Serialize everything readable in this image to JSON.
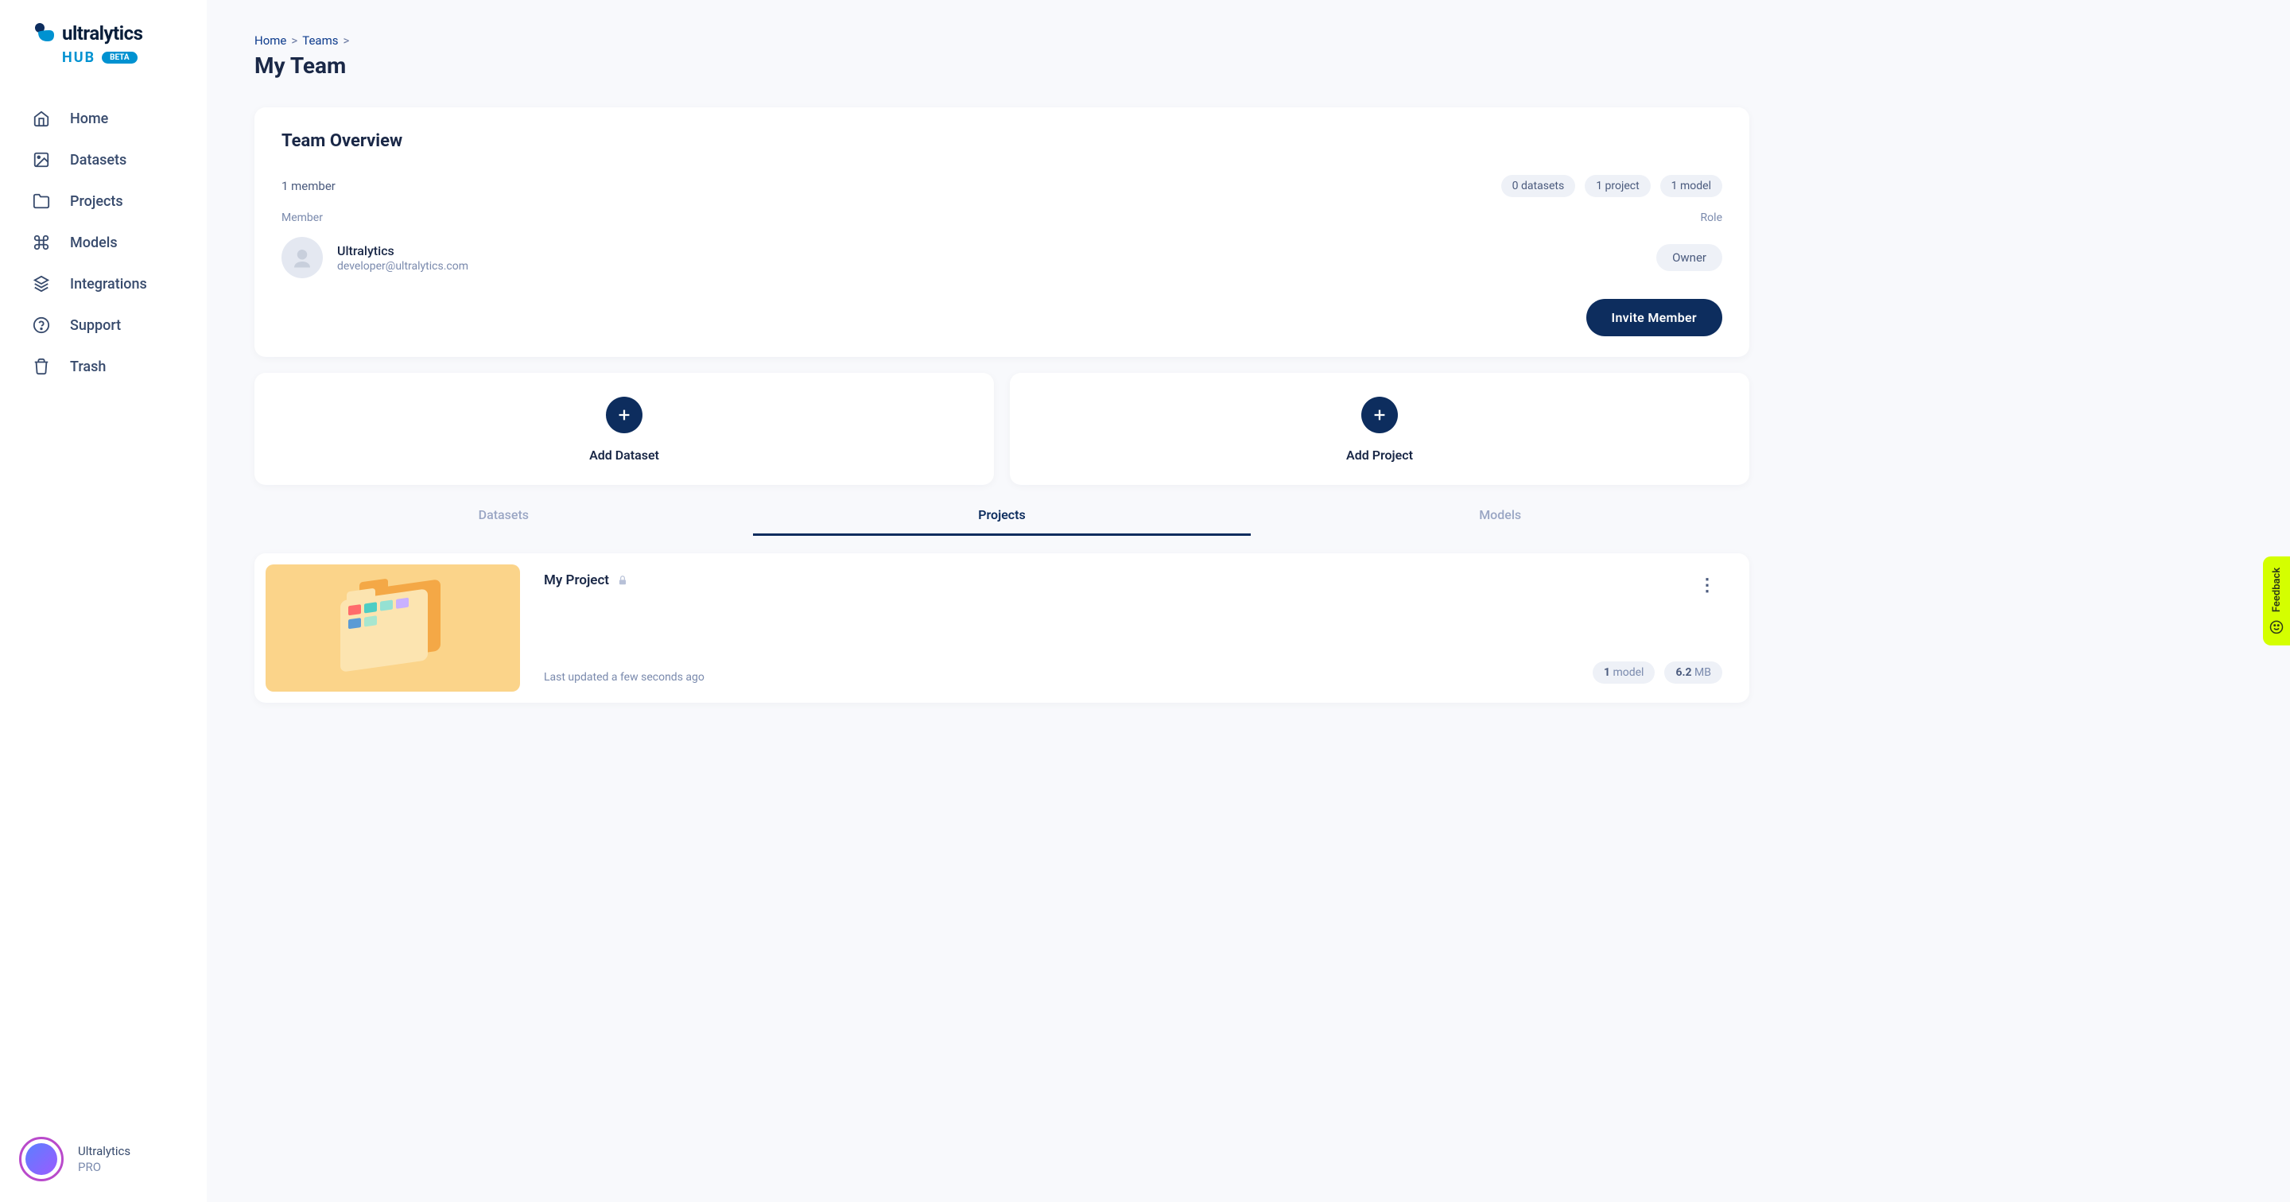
{
  "brand": {
    "name": "ultralytics",
    "sub": "HUB",
    "badge": "BETA"
  },
  "nav": {
    "home": "Home",
    "datasets": "Datasets",
    "projects": "Projects",
    "models": "Models",
    "integrations": "Integrations",
    "support": "Support",
    "trash": "Trash"
  },
  "user": {
    "name": "Ultralytics",
    "plan": "PRO"
  },
  "breadcrumb": {
    "home": "Home",
    "teams": "Teams"
  },
  "page": {
    "title": "My Team"
  },
  "overview": {
    "title": "Team Overview",
    "member_count": "1 member",
    "datasets_pill": "0 datasets",
    "projects_pill": "1 project",
    "models_pill": "1 model",
    "col_member": "Member",
    "col_role": "Role",
    "member_name": "Ultralytics",
    "member_email": "developer@ultralytics.com",
    "role_label": "Owner",
    "invite_label": "Invite Member"
  },
  "add": {
    "dataset": "Add Dataset",
    "project": "Add Project"
  },
  "tabs": {
    "datasets": "Datasets",
    "projects": "Projects",
    "models": "Models"
  },
  "project": {
    "name": "My Project",
    "updated": "Last updated a few seconds ago",
    "model_count": "1",
    "model_label": " model",
    "size_val": "6.2",
    "size_unit": " MB"
  },
  "feedback": {
    "label": "Feedback"
  }
}
